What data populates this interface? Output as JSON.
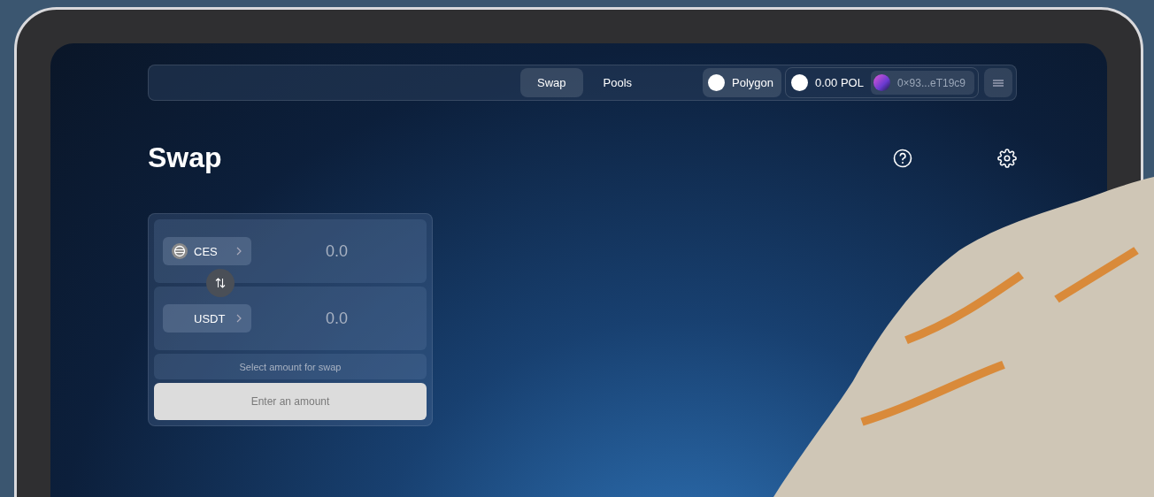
{
  "nav": {
    "tabs": [
      {
        "label": "Swap",
        "selected": true
      },
      {
        "label": "Pools",
        "selected": false
      }
    ],
    "network": "Polygon",
    "balance": "0.00 POL",
    "address": "0×93...eT19c9"
  },
  "title": "Swap",
  "swap": {
    "from": {
      "token": "CES",
      "has_icon": true,
      "amount": "0.0"
    },
    "to": {
      "token": "USDT",
      "has_icon": false,
      "amount": "0.0"
    },
    "hint": "Select amount for swap",
    "button": {
      "label": "Enter an amount",
      "disabled": true
    }
  }
}
